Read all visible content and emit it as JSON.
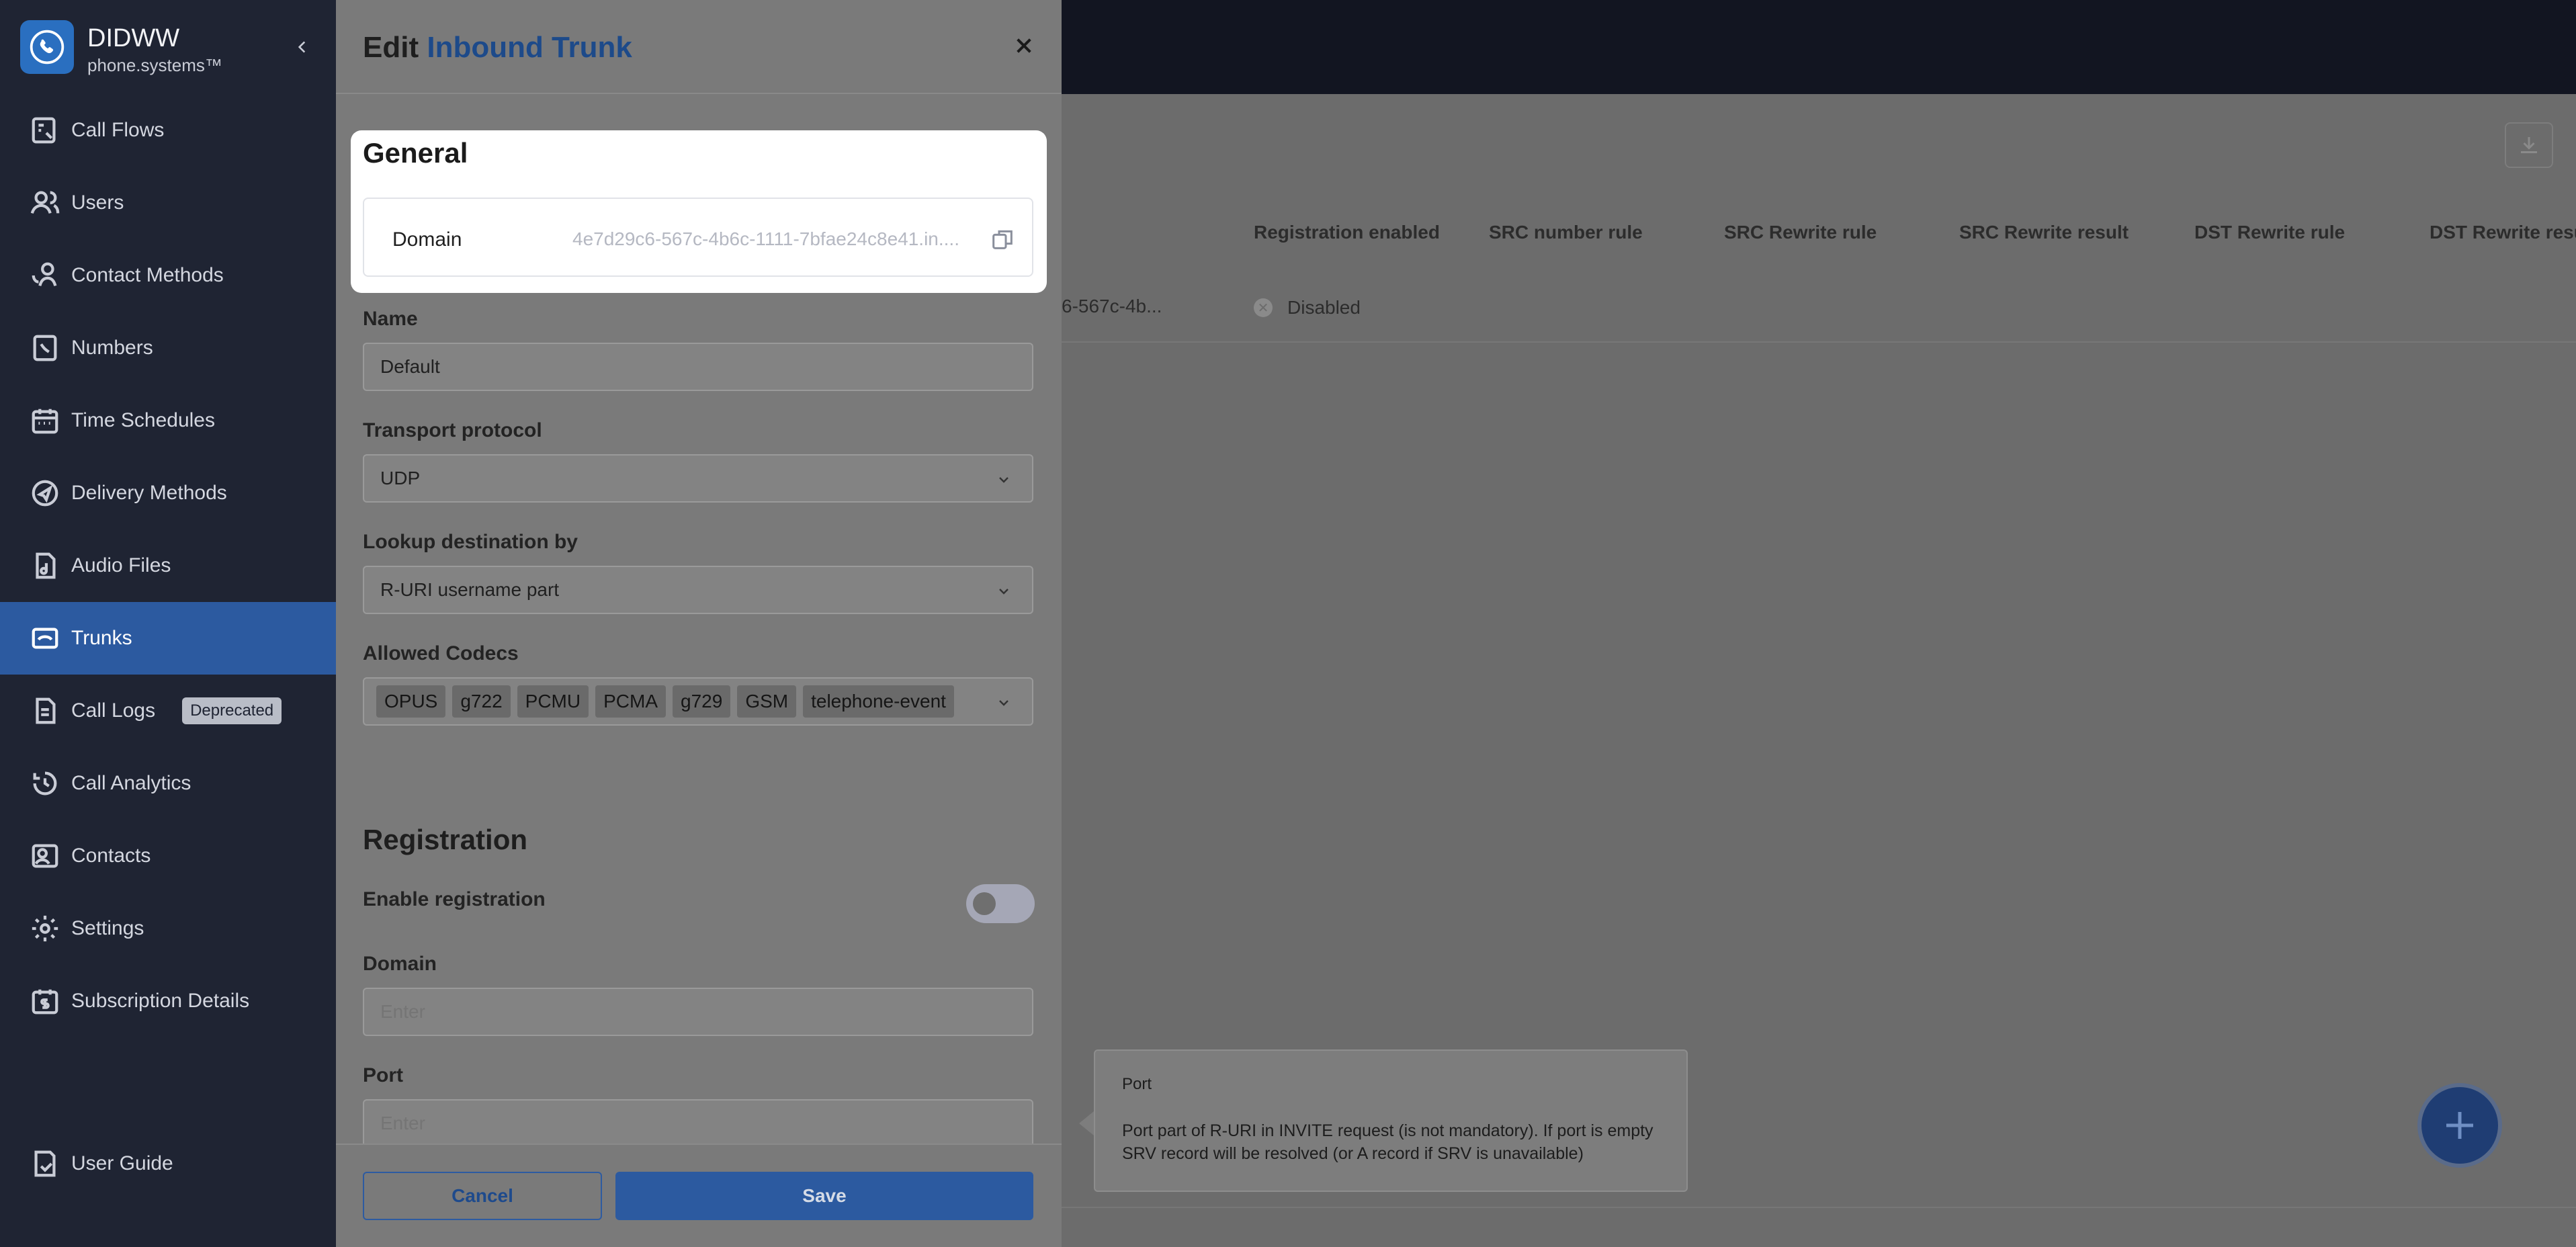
{
  "app": {
    "brand_name": "DIDWW",
    "brand_sub": "phone.systems™"
  },
  "sidebar": {
    "items": [
      {
        "label": "Call Flows",
        "icon": "call-flows-icon"
      },
      {
        "label": "Users",
        "icon": "users-icon"
      },
      {
        "label": "Contact Methods",
        "icon": "contact-methods-icon"
      },
      {
        "label": "Numbers",
        "icon": "numbers-icon"
      },
      {
        "label": "Time Schedules",
        "icon": "calendar-icon"
      },
      {
        "label": "Delivery Methods",
        "icon": "delivery-icon"
      },
      {
        "label": "Audio Files",
        "icon": "audio-file-icon"
      },
      {
        "label": "Trunks",
        "icon": "trunk-icon",
        "active": true
      },
      {
        "label": "Call Logs",
        "icon": "call-logs-icon",
        "badge": "Deprecated"
      },
      {
        "label": "Call Analytics",
        "icon": "analytics-icon"
      },
      {
        "label": "Contacts",
        "icon": "contacts-icon"
      },
      {
        "label": "Settings",
        "icon": "gear-icon"
      },
      {
        "label": "Subscription Details",
        "icon": "subscription-icon"
      }
    ],
    "guide": {
      "label": "User Guide",
      "icon": "guide-icon"
    }
  },
  "table": {
    "headers": [
      "Registration enabled",
      "SRC number rule",
      "SRC Rewrite rule",
      "SRC Rewrite result",
      "DST Rewrite rule",
      "DST Rewrite resu"
    ],
    "row": {
      "domain_partial": "6-567c-4b...",
      "registration": "Disabled"
    }
  },
  "tooltip": {
    "title": "Port",
    "body": "Port part of R-URI in INVITE request (is not mandatory). If port is empty SRV record will be resolved (or A record if SRV is unavailable)"
  },
  "drawer": {
    "title_prefix": "Edit",
    "title_accent": "Inbound Trunk",
    "general": {
      "title": "General",
      "domain_label": "Domain",
      "domain_value": "4e7d29c6-567c-4b6c-1111-7bfae24c8e41.in...."
    },
    "name": {
      "label": "Name",
      "value": "Default"
    },
    "transport": {
      "label": "Transport protocol",
      "value": "UDP"
    },
    "lookup": {
      "label": "Lookup destination by",
      "value": "R-URI username part"
    },
    "codecs": {
      "label": "Allowed Codecs",
      "values": [
        "OPUS",
        "g722",
        "PCMU",
        "PCMA",
        "g729",
        "GSM",
        "telephone-event"
      ]
    },
    "registration": {
      "title": "Registration",
      "enable_label": "Enable registration",
      "enabled": false,
      "domain_label": "Domain",
      "domain_placeholder": "Enter",
      "port_label": "Port",
      "port_placeholder": "Enter"
    },
    "cancel_label": "Cancel",
    "save_label": "Save"
  },
  "colors": {
    "accent": "#2c5aa0",
    "sidebar_bg": "#1f2433",
    "topbar_bg": "#121521"
  }
}
